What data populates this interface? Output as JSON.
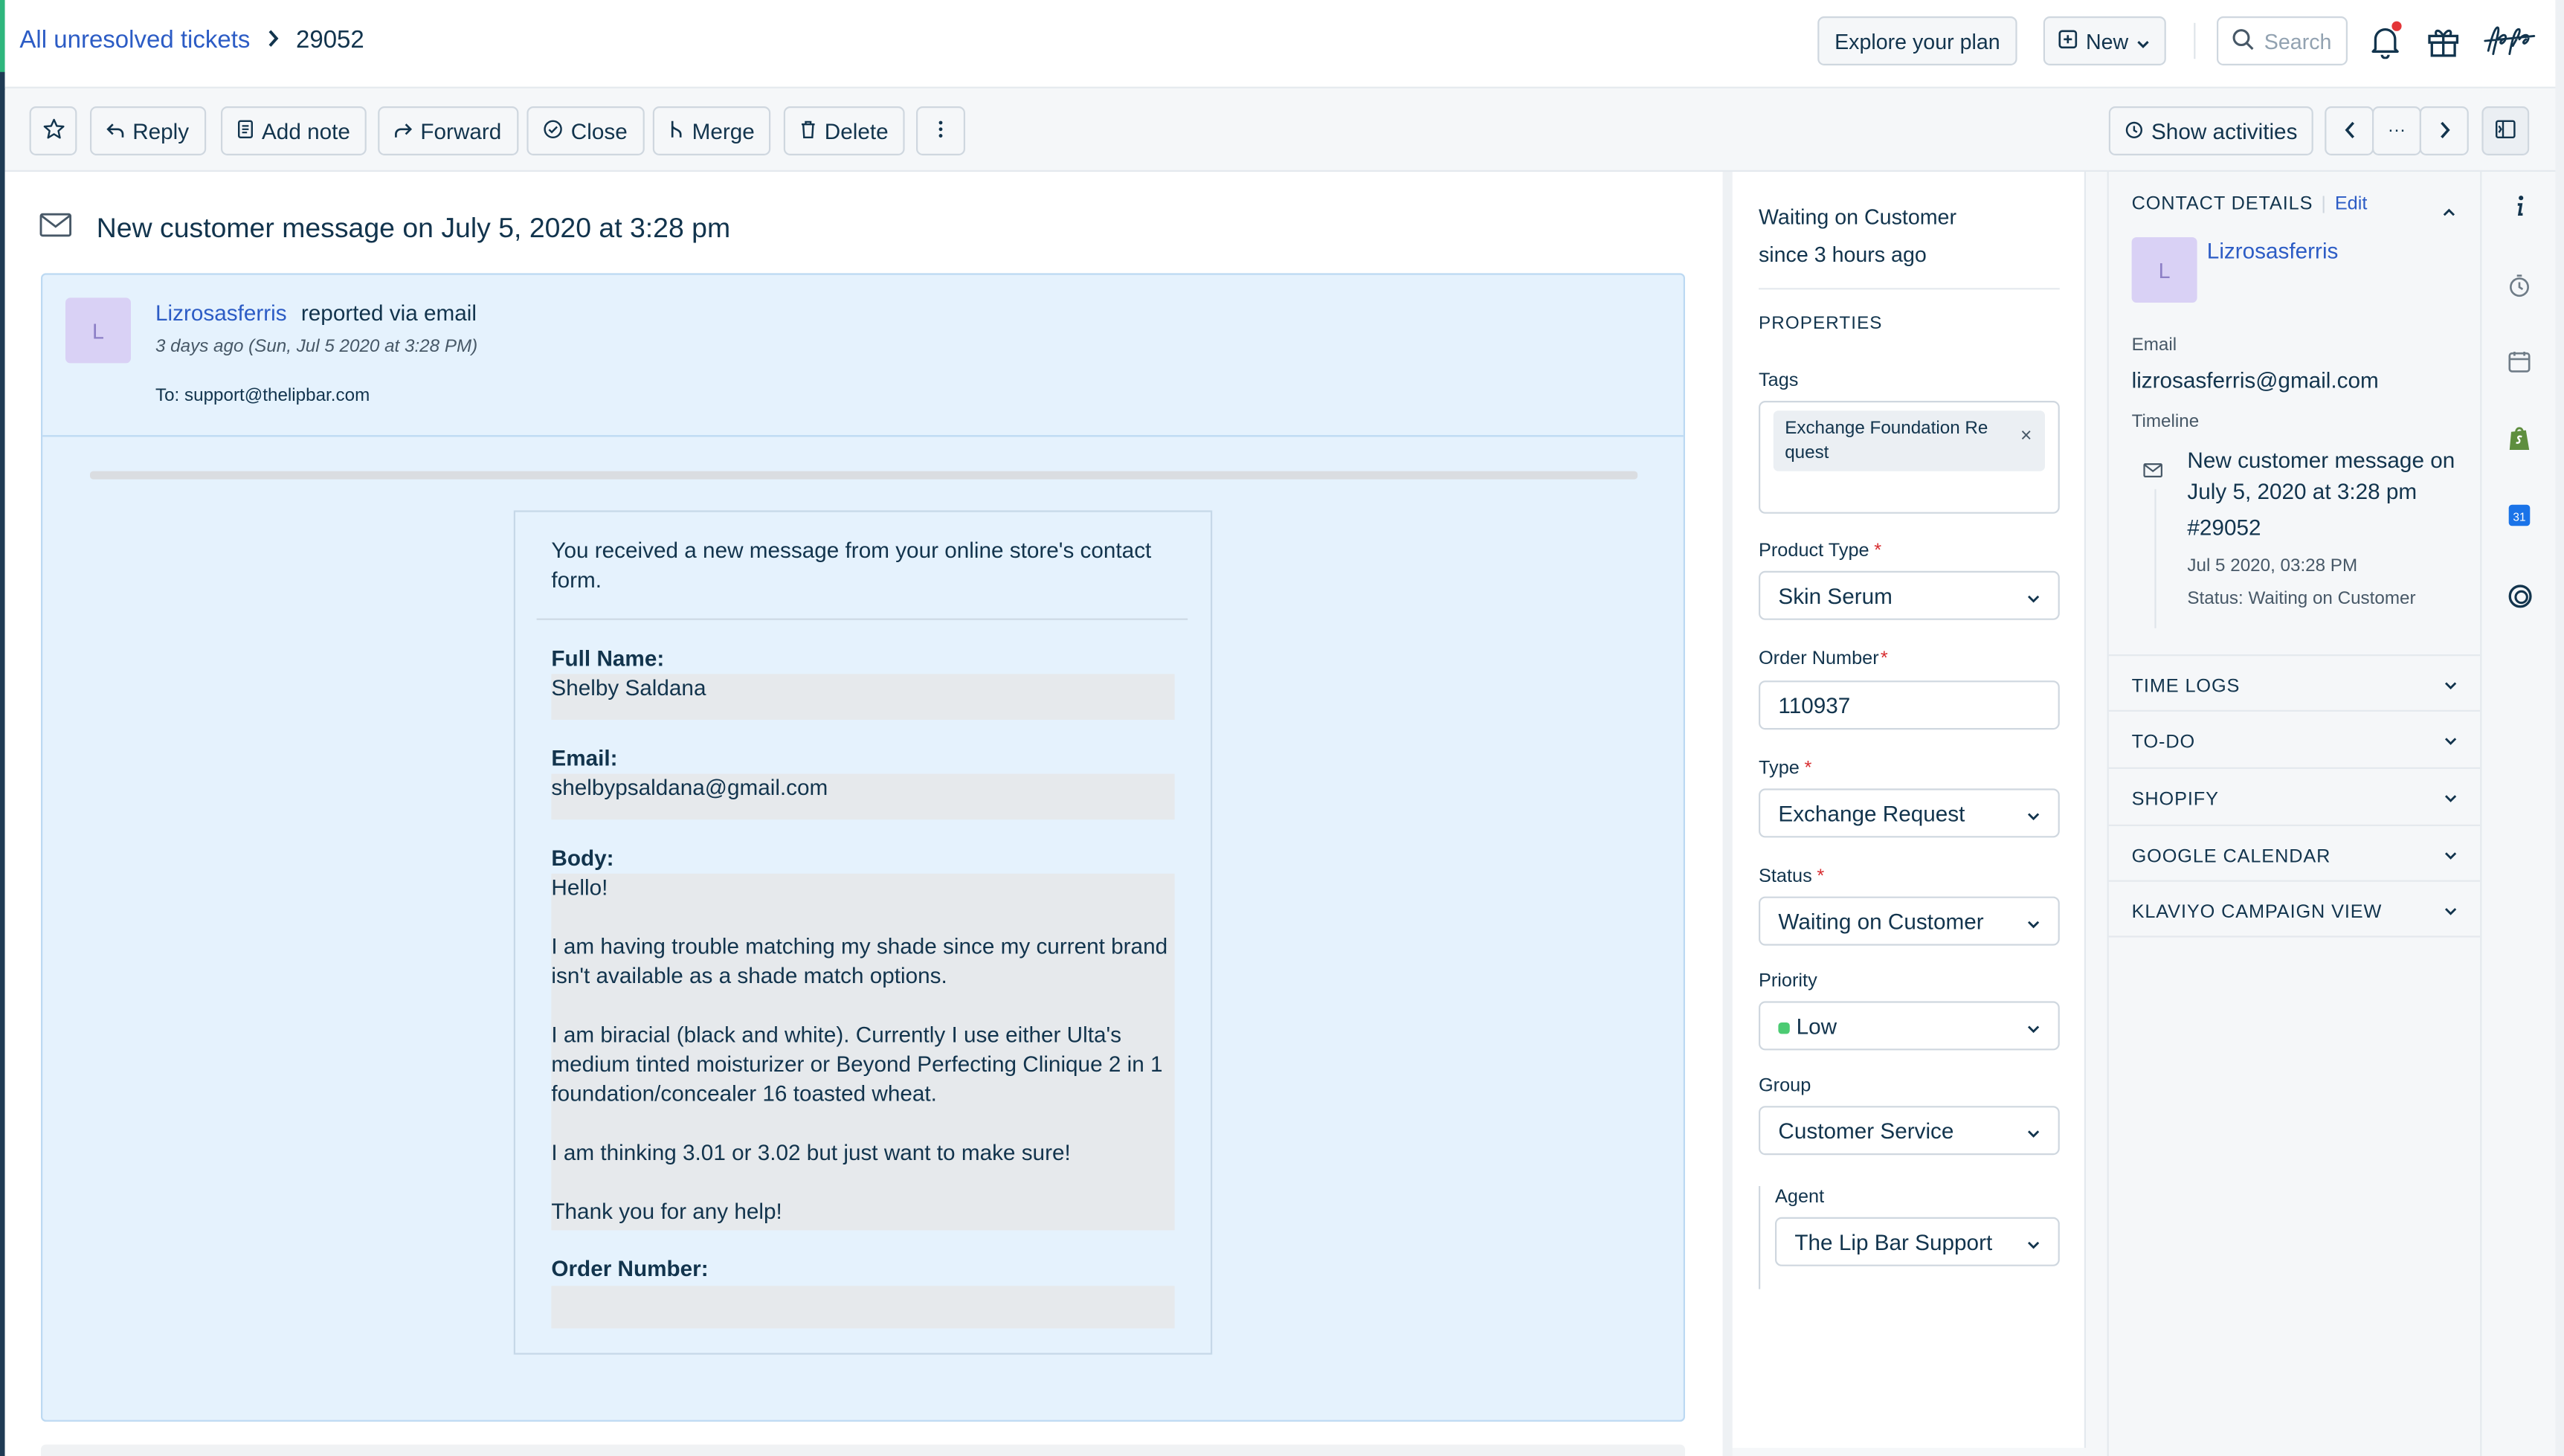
{
  "header": {
    "breadcrumb_link": "All unresolved tickets",
    "ticket_id": "29052",
    "explore_plan": "Explore your plan",
    "new_label": "New",
    "search_placeholder": "Search"
  },
  "toolbar": {
    "reply": "Reply",
    "add_note": "Add note",
    "forward": "Forward",
    "close": "Close",
    "merge": "Merge",
    "delete": "Delete",
    "show_activities": "Show activities",
    "more": "···"
  },
  "ticket": {
    "subject": "New customer message on July 5, 2020 at 3:28 pm",
    "avatar_initial": "L",
    "reporter_name": "Lizrosasferris",
    "reported_via": "reported via email",
    "when": "3 days ago (Sun, Jul 5 2020 at 3:28 PM)",
    "to": "To: support@thelipbar.com",
    "message": {
      "intro": "You received a new message from your online store's contact form.",
      "full_name_label": "Full Name:",
      "full_name": "Shelby Saldana",
      "email_label": "Email:",
      "email": "shelbypsaldana@gmail.com",
      "body_label": "Body:",
      "body": [
        "Hello!",
        "I am having trouble matching my shade since my current brand isn't available as a shade match options.",
        "I am biracial (black and white). Currently I use either Ulta's medium tinted moisturizer or Beyond Perfecting Clinique 2 in 1 foundation/concealer 16 toasted wheat.",
        "I am thinking 3.01 or 3.02 but just want to make sure!",
        "Thank you for any help!"
      ],
      "order_label": "Order Number:",
      "order_value": ""
    }
  },
  "properties": {
    "status_title": "Waiting on Customer",
    "status_since": "since 3 hours ago",
    "heading": "PROPERTIES",
    "tags_label": "Tags",
    "tag": "Exchange Foundation Re quest",
    "tag_remove": "×",
    "product_type_label": "Product Type",
    "product_type": "Skin Serum",
    "order_number_label": "Order Number",
    "order_number": "110937",
    "type_label": "Type",
    "type": "Exchange Request",
    "status_label": "Status",
    "status": "Waiting on Customer",
    "priority_label": "Priority",
    "priority": "Low",
    "priority_color": "#4ccb73",
    "group_label": "Group",
    "group": "Customer Service",
    "agent_label": "Agent",
    "agent": "The Lip Bar Support",
    "required_mark": "*"
  },
  "contact": {
    "heading": "CONTACT DETAILS",
    "edit": "Edit",
    "avatar_initial": "L",
    "name": "Lizrosasferris",
    "email_label": "Email",
    "email": "lizrosasferris@gmail.com",
    "timeline_label": "Timeline",
    "timeline_title": "New customer message on July 5, 2020 at 3:28 pm",
    "timeline_number": "#29052",
    "timeline_date": "Jul 5 2020, 03:28 PM",
    "timeline_status": "Status: Waiting on Customer"
  },
  "sections": [
    "TIME LOGS",
    "TO-DO",
    "SHOPIFY",
    "GOOGLE CALENDAR",
    "KLAVIYO CAMPAIGN VIEW"
  ],
  "icons": {
    "rail": [
      "info-icon",
      "timer-icon",
      "calendar-icon",
      "shopify-icon",
      "google-calendar-icon",
      "klaviyo-icon"
    ],
    "calendar_day": "31"
  },
  "colors": {
    "link": "#2c5cc5",
    "card_bg": "#e5f2fd",
    "required": "#d72d30",
    "brand_accent": "#2eb67d"
  }
}
